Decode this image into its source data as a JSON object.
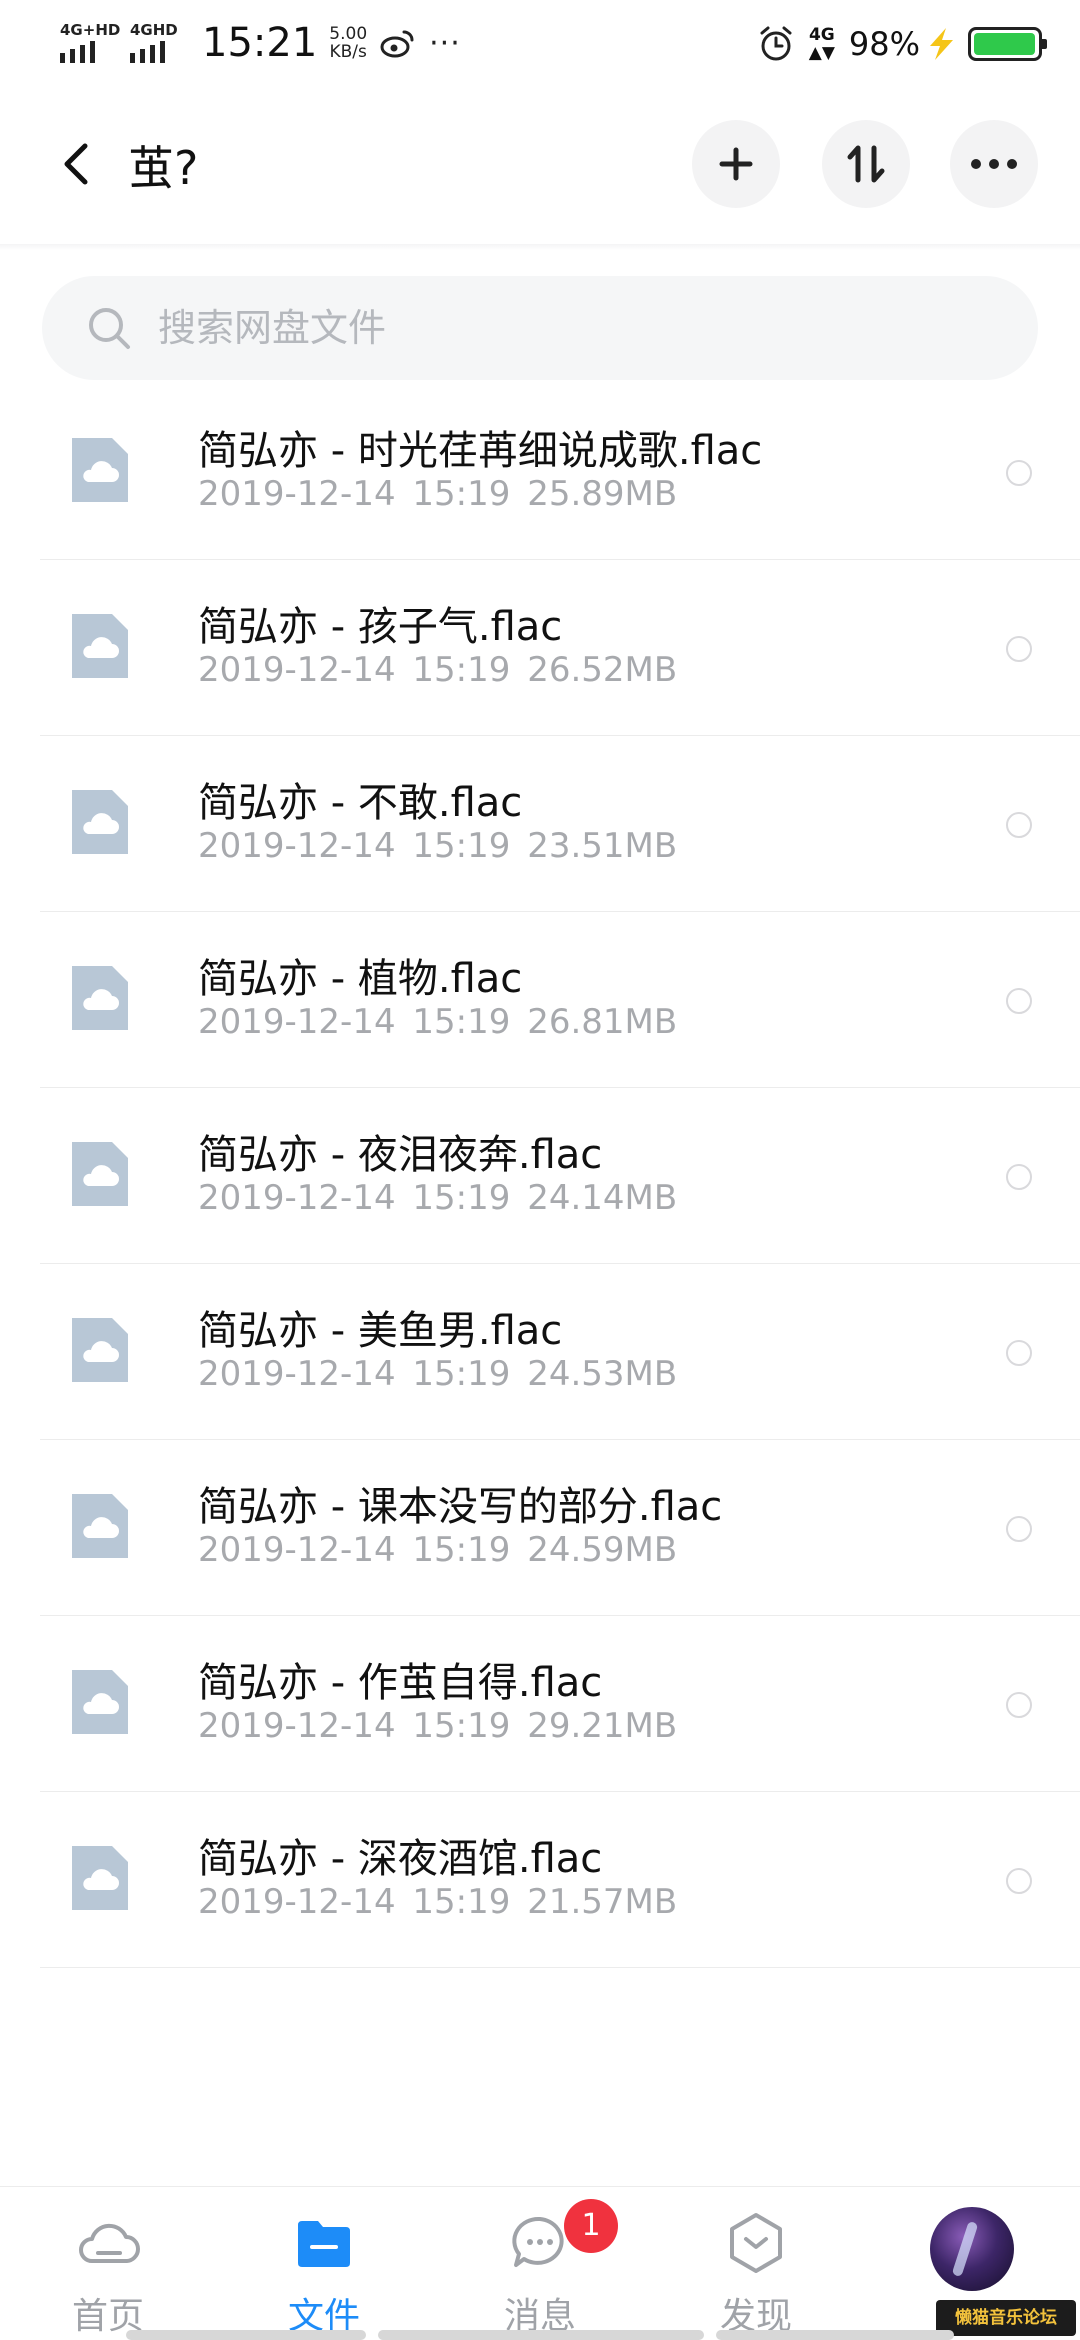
{
  "status_bar": {
    "sim1": "4G+HD",
    "sim2": "4GHD",
    "time": "15:21",
    "speed_value": "5.00",
    "speed_unit": "KB/s",
    "more": "···",
    "net": "4G",
    "battery_text": "98%",
    "battery_level": 0.98,
    "battery_color": "#2fc94b"
  },
  "header": {
    "title": "茧?",
    "back_icon": "chevron-left-icon",
    "add_icon": "plus-icon",
    "sort_icon": "sort-icon",
    "more_icon": "more-icon"
  },
  "search": {
    "placeholder": "搜索网盘文件",
    "icon": "search-icon"
  },
  "files": [
    {
      "name": "简弘亦 - 时光荏苒细说成歌.flac",
      "date": "2019-12-14",
      "time": "15:19",
      "size": "25.89MB"
    },
    {
      "name": "简弘亦 - 孩子气.flac",
      "date": "2019-12-14",
      "time": "15:19",
      "size": "26.52MB"
    },
    {
      "name": "简弘亦 - 不敢.flac",
      "date": "2019-12-14",
      "time": "15:19",
      "size": "23.51MB"
    },
    {
      "name": "简弘亦 - 植物.flac",
      "date": "2019-12-14",
      "time": "15:19",
      "size": "26.81MB"
    },
    {
      "name": "简弘亦 - 夜泪夜奔.flac",
      "date": "2019-12-14",
      "time": "15:19",
      "size": "24.14MB"
    },
    {
      "name": "简弘亦 - 美鱼男.flac",
      "date": "2019-12-14",
      "time": "15:19",
      "size": "24.53MB"
    },
    {
      "name": "简弘亦 - 课本没写的部分.flac",
      "date": "2019-12-14",
      "time": "15:19",
      "size": "24.59MB"
    },
    {
      "name": "简弘亦 - 作茧自得.flac",
      "date": "2019-12-14",
      "time": "15:19",
      "size": "29.21MB"
    },
    {
      "name": "简弘亦 - 深夜酒馆.flac",
      "date": "2019-12-14",
      "time": "15:19",
      "size": "21.57MB"
    }
  ],
  "bottom_nav": {
    "items": [
      {
        "label": "首页",
        "icon": "cloud-icon",
        "active": false
      },
      {
        "label": "文件",
        "icon": "folder-icon",
        "active": true
      },
      {
        "label": "消息",
        "icon": "chat-icon",
        "active": false,
        "badge": "1"
      },
      {
        "label": "发现",
        "icon": "cube-icon",
        "active": false
      }
    ],
    "active_color": "#1d8cf8",
    "badge_color": "#f0323e"
  },
  "watermark": "懒猫音乐论坛"
}
